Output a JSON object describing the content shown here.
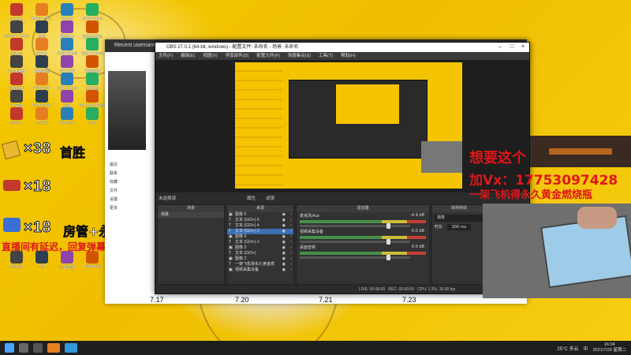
{
  "desktop": {
    "overlays": {
      "line1_num": "×38",
      "line1_text": "首胜",
      "line2_num": "×18",
      "line3_num": "×18",
      "line3_text": "房管+永久车位",
      "delay_note": "直播间有延迟，回复弹幕比较慢",
      "promo_line1": "想要这个",
      "promo_line2": "加Vx：17753097428",
      "promo_line3": "一架飞机得永久黄金燃烧瓶"
    },
    "icons": [
      "此电脑",
      "Adobe Pho..",
      "Photos",
      "WPS Office",
      "Google Chrome",
      "微信",
      "腾讯QQ",
      "网易云音乐",
      "回收站",
      "Steam",
      "OBS Studio",
      "Epic Games",
      "UU加速器",
      "英雄联盟",
      "VS Code",
      "百度网盘",
      "控制面板",
      "WeGame",
      "Call of Duty",
      "QQ音乐",
      "YY语音",
      "Photoshop",
      "迅雷",
      "Microsoft Edge",
      "Power...",
      "CS:GO",
      "GeForce",
      "7-Zip",
      "Discord",
      "TIM",
      "斗鱼直播",
      "Bandicam"
    ]
  },
  "browser": {
    "tab_title": "Recent username",
    "side_items": [
      "最近",
      "联系",
      "收藏",
      "文件",
      "设置",
      "更多"
    ]
  },
  "obs": {
    "title": "OBS 27.0.1 (64-bit, windows) - 配置文件: 未命名 - 场景: 未命名",
    "menu": [
      "文件(F)",
      "编辑(E)",
      "视图(V)",
      "停靠部件(D)",
      "配置文件(P)",
      "场景集合(S)",
      "工具(T)",
      "帮助(H)"
    ],
    "no_source": "未选择源",
    "props_btn": "属性",
    "filters_btn": "滤镜",
    "docks": {
      "scenes": "场景",
      "sources": "来源",
      "mixer": "混音器",
      "transitions": "转场特效"
    },
    "scene_items": [
      "场景"
    ],
    "sources": [
      {
        "name": "图像 5",
        "type": "img"
      },
      {
        "name": "文本 (GDI+) 5",
        "type": "txt"
      },
      {
        "name": "文本 (GDI+) 4",
        "type": "txt"
      },
      {
        "name": "文本 (GDI+) 3",
        "type": "txt",
        "selected": true
      },
      {
        "name": "图像 4",
        "type": "img"
      },
      {
        "name": "文本 (GDI+) 2",
        "type": "txt"
      },
      {
        "name": "图像 3",
        "type": "img"
      },
      {
        "name": "文本 (GDI+)",
        "type": "txt"
      },
      {
        "name": "图像 2",
        "type": "img"
      },
      {
        "name": "一架飞机得永久黄金燃",
        "type": "txt"
      },
      {
        "name": "视频采集设备",
        "type": "img"
      }
    ],
    "mixer": [
      {
        "name": "麦克风/Aux",
        "db": "-4.9 dB"
      },
      {
        "name": "视频采集设备",
        "db": "0.0 dB"
      },
      {
        "name": "桌面音频",
        "db": "0.0 dB"
      }
    ],
    "transition": {
      "type": "渐变",
      "duration_label": "时长",
      "duration": "300 ms"
    },
    "status": {
      "live": "LIVE: 00:00:00",
      "rec": "REC: 00:00:00",
      "cpu": "CPU: 1.3%, 30.00 fps"
    }
  },
  "axis_dates": [
    "7.17",
    "7.20",
    "7.21",
    "7.23"
  ],
  "taskbar": {
    "weather": "25°C 多云",
    "time": "16:04",
    "date": "2021/7/20 星期二",
    "ime": "中"
  },
  "colors": {
    "accent": "#3d6fb5",
    "wallpaper": "#f2c400",
    "promo": "#e0161a"
  }
}
